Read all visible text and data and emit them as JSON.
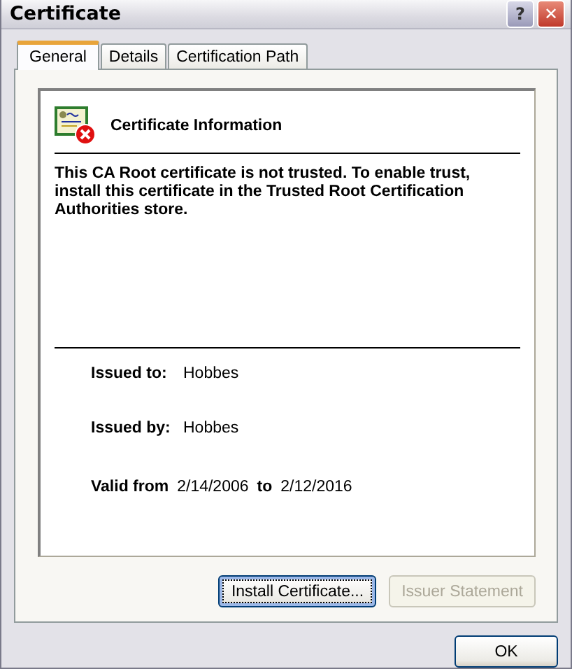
{
  "window": {
    "title": "Certificate"
  },
  "title_buttons": [
    {
      "kind": "help",
      "label": "?"
    },
    {
      "kind": "close",
      "label": "✕"
    }
  ],
  "tabs": [
    {
      "label": "General",
      "selected": true
    },
    {
      "label": "Details",
      "selected": false
    },
    {
      "label": "Certification Path",
      "selected": false
    }
  ],
  "info": {
    "title": "Certificate Information",
    "message": "This CA Root certificate is not trusted. To enable trust, install this certificate in the Trusted Root Certification Authorities store.",
    "trusted": false
  },
  "issued_to": {
    "label": "Issued to:",
    "value": "Hobbes"
  },
  "issued_by": {
    "label": "Issued by:",
    "value": "Hobbes"
  },
  "validity": {
    "from_label": "Valid from",
    "from": "2/14/2006",
    "to_label": "to",
    "to": "2/12/2016"
  },
  "buttons": [
    {
      "label": "Install Certificate...",
      "disabled": false,
      "focused": true
    },
    {
      "label": "Issuer Statement",
      "disabled": true,
      "focused": false
    }
  ],
  "ok_button": {
    "label": "OK"
  }
}
